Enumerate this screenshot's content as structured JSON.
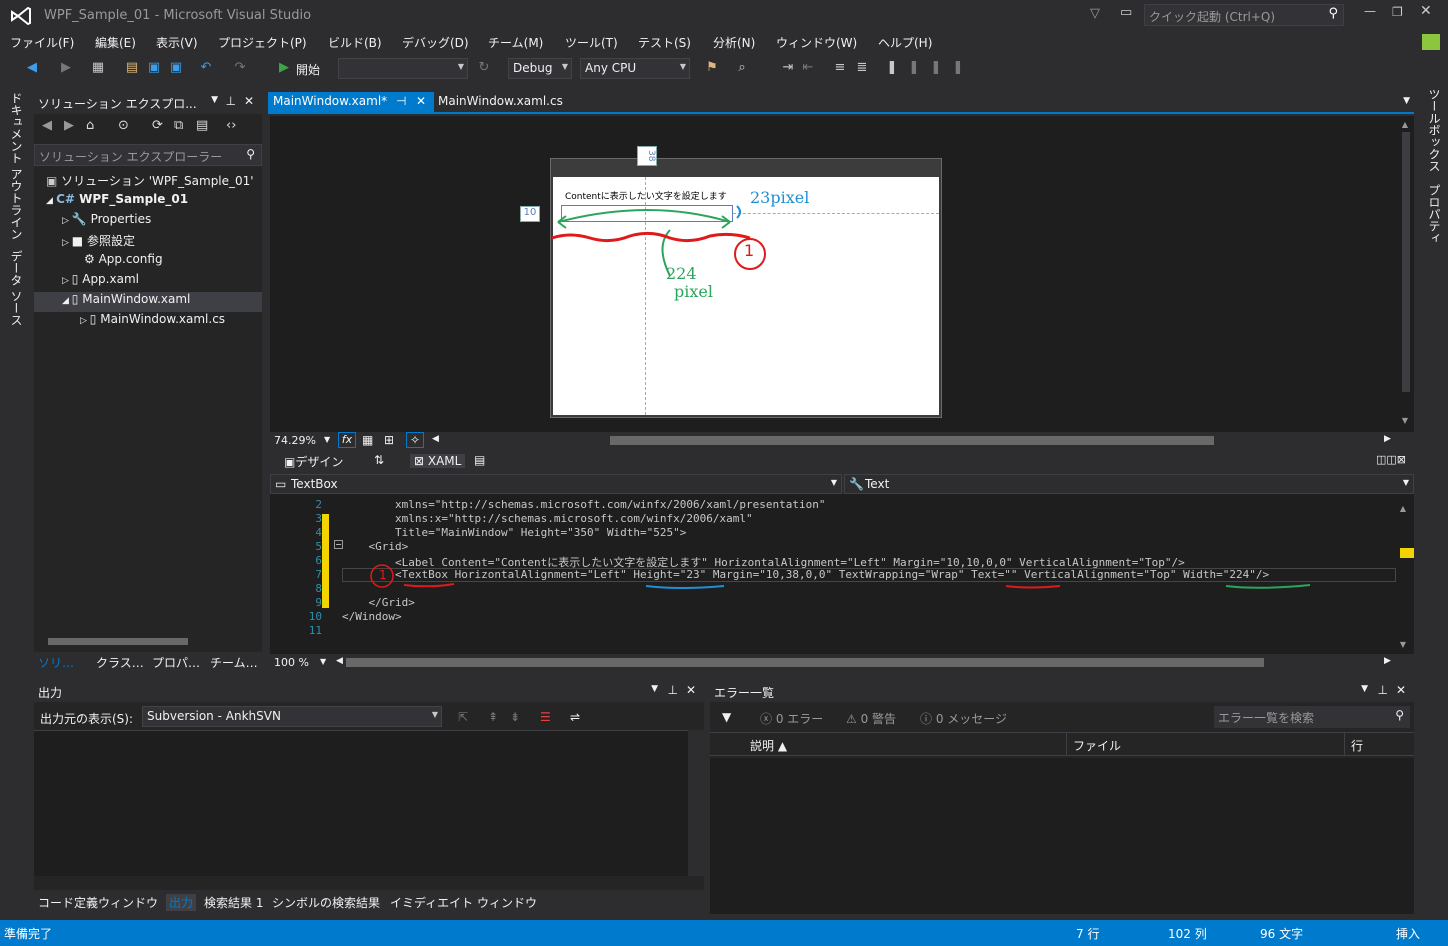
{
  "window": {
    "title": "WPF_Sample_01 - Microsoft Visual Studio",
    "quick_launch_placeholder": "クイック起動 (Ctrl+Q)"
  },
  "menu": [
    "ファイル(F)",
    "編集(E)",
    "表示(V)",
    "プロジェクト(P)",
    "ビルド(B)",
    "デバッグ(D)",
    "チーム(M)",
    "ツール(T)",
    "テスト(S)",
    "分析(N)",
    "ウィンドウ(W)",
    "ヘルプ(H)"
  ],
  "toolbar": {
    "start_label": "開始",
    "config": "Debug",
    "platform": "Any CPU"
  },
  "left_strip": {
    "doc_outline": "ドキュメント アウトライン",
    "data_source": "データ ソース"
  },
  "right_strip": {
    "toolbox": "ツールボックス",
    "properties": "プロパティ"
  },
  "solution_explorer": {
    "title": "ソリューション エクスプロ...",
    "search_placeholder": "ソリューション エクスプローラー",
    "items": [
      "ソリューション 'WPF_Sample_01'",
      "WPF_Sample_01",
      "Properties",
      "参照設定",
      "App.config",
      "App.xaml",
      "MainWindow.xaml",
      "MainWindow.xaml.cs"
    ],
    "tabs": [
      "ソリ…",
      "クラス…",
      "プロパ…",
      "チーム…"
    ]
  },
  "editor_tabs": [
    "MainWindow.xaml*",
    "MainWindow.xaml.cs"
  ],
  "designer": {
    "label_content": "Contentに表示したい文字を設定します",
    "margin_top": "38",
    "margin_left": "10",
    "annot_height": "23pixel",
    "annot_width_1": "224",
    "annot_width_2": "pixel",
    "annot_num": "1",
    "zoom": "74.29%",
    "fx": "fx",
    "view_tabs": {
      "design": "デザイン",
      "xaml": "XAML"
    }
  },
  "xaml": {
    "element_combo": "TextBox",
    "property_combo": "Text",
    "line_numbers": [
      "2",
      "3",
      "4",
      "5",
      "6",
      "7",
      "8",
      "9",
      "10",
      "11"
    ],
    "lines": [
      "        xmlns=\"http://schemas.microsoft.com/winfx/2006/xaml/presentation\"",
      "        xmlns:x=\"http://schemas.microsoft.com/winfx/2006/xaml\"",
      "        Title=\"MainWindow\" Height=\"350\" Width=\"525\">",
      "    <Grid>",
      "        <Label Content=\"Contentに表示したい文字を設定します\" HorizontalAlignment=\"Left\" Margin=\"10,10,0,0\" VerticalAlignment=\"Top\"/>",
      "        <TextBox HorizontalAlignment=\"Left\" Height=\"23\" Margin=\"10,38,0,0\" TextWrapping=\"Wrap\" Text=\"\" VerticalAlignment=\"Top\" Width=\"224\"/>",
      "",
      "    </Grid>",
      "</Window>",
      ""
    ],
    "zoom": "100 %"
  },
  "output": {
    "title": "出力",
    "source_label": "出力元の表示(S):",
    "source": "Subversion - AnkhSVN"
  },
  "bottom_tabs": [
    "コード定義ウィンドウ",
    "出力",
    "検索結果 1",
    "シンボルの検索結果",
    "イミディエイト ウィンドウ"
  ],
  "error_list": {
    "title": "エラー一覧",
    "errors": "0 エラー",
    "warnings": "0 警告",
    "messages": "0 メッセージ",
    "search_placeholder": "エラー一覧を検索",
    "columns": [
      "説明",
      "ファイル",
      "行"
    ]
  },
  "status": {
    "ready": "準備完了",
    "line": "7 行",
    "col": "102 列",
    "ch": "96 文字",
    "mode": "挿入"
  },
  "colors": {
    "accent": "#007acc",
    "bg": "#2d2d30",
    "panel": "#252526",
    "editor": "#1e1e1e"
  }
}
